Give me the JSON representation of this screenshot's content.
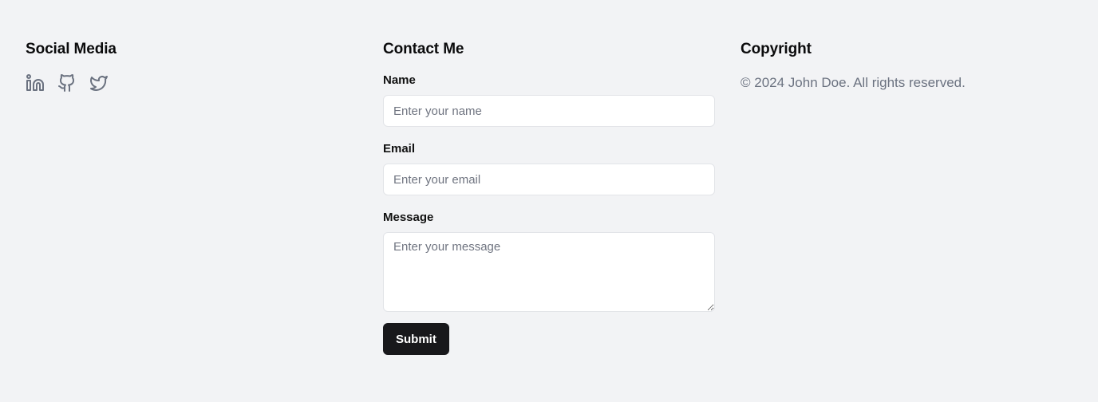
{
  "social": {
    "title": "Social Media",
    "icons": [
      "linkedin-icon",
      "github-icon",
      "twitter-icon"
    ],
    "icon_color": "#6b7280"
  },
  "contact": {
    "title": "Contact Me",
    "name_label": "Name",
    "name_placeholder": "Enter your name",
    "email_label": "Email",
    "email_placeholder": "Enter your email",
    "message_label": "Message",
    "message_placeholder": "Enter your message",
    "submit_label": "Submit"
  },
  "copyright": {
    "title": "Copyright",
    "text": "© 2024 John Doe. All rights reserved."
  },
  "colors": {
    "background": "#f2f3f5",
    "button": "#18181b",
    "muted_text": "#6b7280"
  }
}
